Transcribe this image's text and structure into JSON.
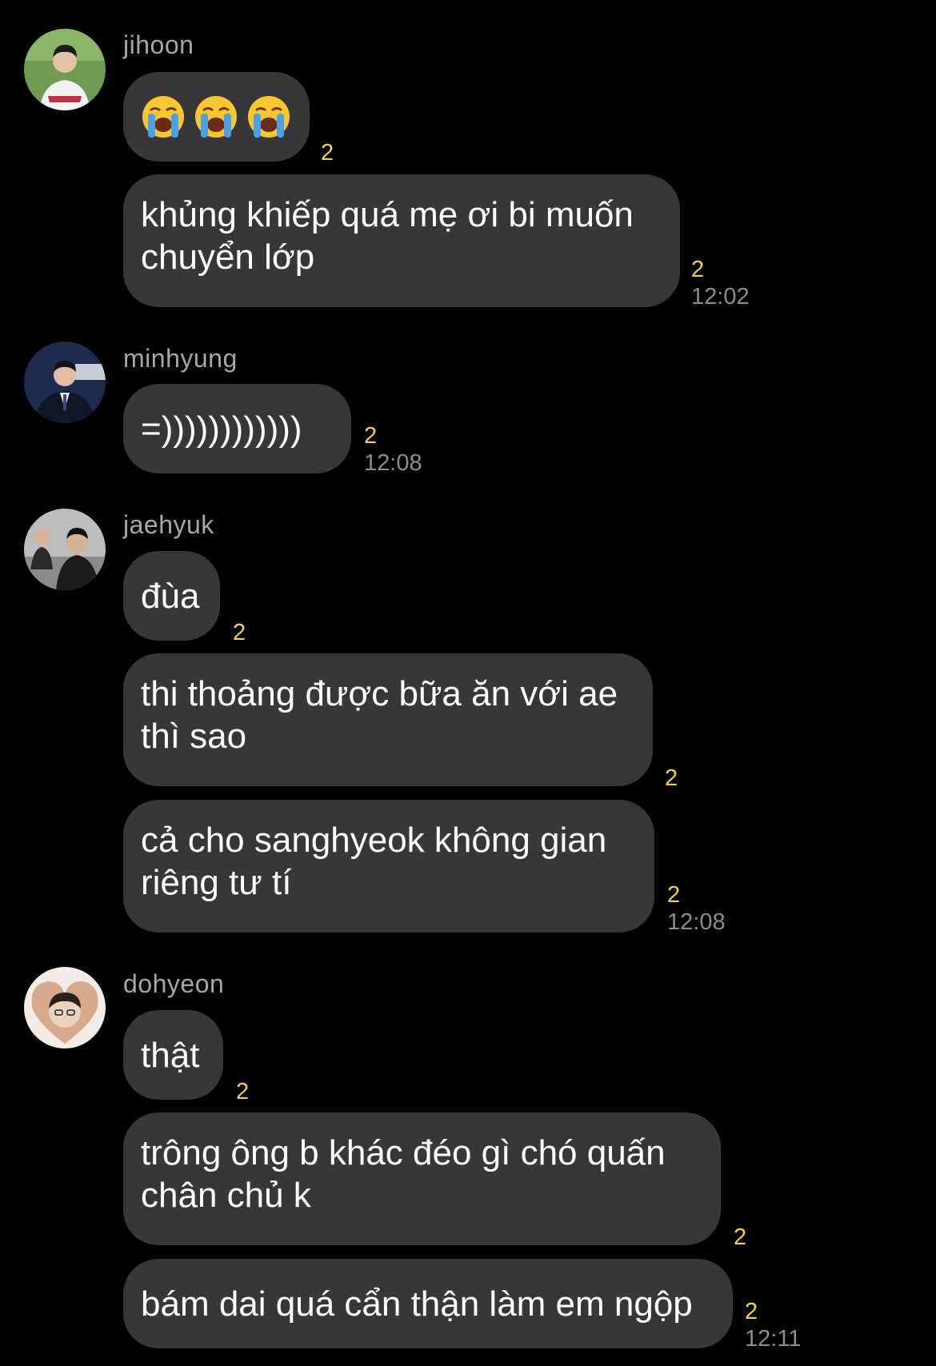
{
  "messages": [
    {
      "sender": "jihoon",
      "avatar_icon": "avatar-jihoon",
      "bubbles": [
        {
          "kind": "emoji",
          "emoji": [
            "loudly-crying-face",
            "loudly-crying-face",
            "loudly-crying-face"
          ],
          "unread": "2",
          "time": ""
        },
        {
          "kind": "text",
          "text": "khủng khiếp quá mẹ ơi bi muốn\nchuyển lớp",
          "unread": "2",
          "time": "12:02"
        }
      ]
    },
    {
      "sender": "minhyung",
      "avatar_icon": "avatar-minhyung",
      "bubbles": [
        {
          "kind": "text",
          "text": "=))))))))))))",
          "unread": "2",
          "time": "12:08"
        }
      ]
    },
    {
      "sender": "jaehyuk",
      "avatar_icon": "avatar-jaehyuk",
      "bubbles": [
        {
          "kind": "text",
          "text": "đùa",
          "unread": "2",
          "time": ""
        },
        {
          "kind": "text",
          "text": "thi thoảng được bữa ăn với ae\nthì sao",
          "unread": "2",
          "time": ""
        },
        {
          "kind": "text",
          "text": "cả cho sanghyeok không gian\nriêng tư tí",
          "unread": "2",
          "time": "12:08"
        }
      ]
    },
    {
      "sender": "dohyeon",
      "avatar_icon": "avatar-dohyeon",
      "bubbles": [
        {
          "kind": "text",
          "text": "thật",
          "unread": "2",
          "time": ""
        },
        {
          "kind": "text",
          "text": "trông ông b khác đéo gì chó quấn\nchân chủ k",
          "unread": "2",
          "time": ""
        },
        {
          "kind": "text",
          "text": "bám dai quá cẩn thận làm em ngộp",
          "unread": "2",
          "time": "12:11"
        }
      ]
    }
  ],
  "colors": {
    "background": "#000000",
    "bubble": "#37373a",
    "sender_name": "#a7a7a7",
    "unread_count": "#f4d33f",
    "timestamp": "#8d8d8f"
  }
}
